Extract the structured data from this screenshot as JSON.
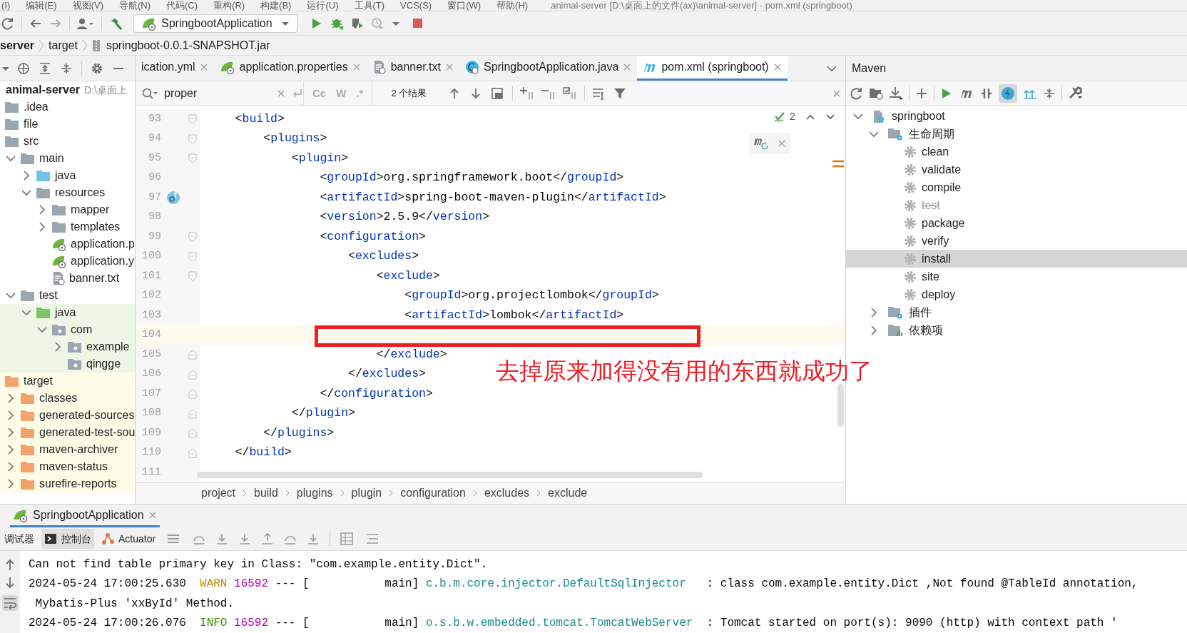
{
  "menu_bar": {
    "items": [
      "(I)",
      "编辑(E)",
      "视图(V)",
      "导航(N)",
      "代码(C)",
      "重构(R)",
      "构建(B)",
      "运行(U)",
      "工具(T)",
      "VCS(S)",
      "窗口(W)",
      "帮助(H)"
    ],
    "title": "animal-server [D:\\桌面上的文件(ax)\\animal-server] - pom.xml (springboot)"
  },
  "toolbar": {
    "run_configuration": "SpringbootApplication"
  },
  "navigation_bar": [
    {
      "label": "server",
      "kind": "project"
    },
    {
      "label": "target",
      "kind": "folder"
    },
    {
      "label": "springboot-0.0.1-SNAPSHOT.jar",
      "kind": "jar"
    }
  ],
  "project_panel": {
    "tree": [
      {
        "label": "animal-server",
        "kind": "module",
        "path_hint": "D:\\桌面上",
        "children": [
          {
            "label": ".idea",
            "kind": "folder"
          },
          {
            "label": "file",
            "kind": "folder"
          },
          {
            "label": "src",
            "kind": "folder",
            "children": [
              {
                "label": "main",
                "kind": "folder",
                "expanded": true,
                "children": [
                  {
                    "label": "java",
                    "kind": "source-folder",
                    "expanded": false
                  },
                  {
                    "label": "resources",
                    "kind": "resources-folder",
                    "expanded": true,
                    "children": [
                      {
                        "label": "mapper",
                        "kind": "folder",
                        "expanded": false
                      },
                      {
                        "label": "templates",
                        "kind": "folder",
                        "expanded": false
                      },
                      {
                        "label": "application.p",
                        "kind": "spring-file"
                      },
                      {
                        "label": "application.y",
                        "kind": "spring-file"
                      },
                      {
                        "label": "banner.txt",
                        "kind": "text-file"
                      }
                    ]
                  }
                ]
              },
              {
                "label": "test",
                "kind": "folder",
                "expanded": true,
                "children": [
                  {
                    "label": "java",
                    "kind": "test-folder",
                    "expanded": true,
                    "test_source": true,
                    "children": [
                      {
                        "label": "com",
                        "kind": "package",
                        "expanded": true,
                        "test_source": true,
                        "children": [
                          {
                            "label": "example",
                            "kind": "package",
                            "expanded": false,
                            "test_source": true
                          },
                          {
                            "label": "qingge",
                            "kind": "package",
                            "test_source": true
                          }
                        ]
                      }
                    ]
                  }
                ]
              }
            ]
          },
          {
            "label": "target",
            "kind": "excluded-folder",
            "excluded": true,
            "children": [
              {
                "label": "classes",
                "kind": "excluded-folder",
                "expanded": false,
                "excluded": true
              },
              {
                "label": "generated-sources",
                "kind": "excluded-folder",
                "expanded": false,
                "excluded": true
              },
              {
                "label": "generated-test-sou",
                "kind": "excluded-folder",
                "expanded": false,
                "excluded": true
              },
              {
                "label": "maven-archiver",
                "kind": "excluded-folder",
                "expanded": false,
                "excluded": true
              },
              {
                "label": "maven-status",
                "kind": "excluded-folder",
                "expanded": false,
                "excluded": true
              },
              {
                "label": "surefire-reports",
                "kind": "excluded-folder",
                "expanded": false,
                "excluded": true
              }
            ]
          }
        ]
      }
    ]
  },
  "editor": {
    "tabs": [
      {
        "label": "ication.yml",
        "selected": false
      },
      {
        "label": "application.properties",
        "kind": "spring-file",
        "selected": false
      },
      {
        "label": "banner.txt",
        "kind": "text-file",
        "selected": false
      },
      {
        "label": "SpringbootApplication.java",
        "kind": "java-file",
        "selected": false
      },
      {
        "label": "pom.xml (springboot)",
        "kind": "maven-file",
        "selected": true
      }
    ],
    "search": {
      "value": "proper",
      "toggles": [
        "Cc",
        "W",
        ".*"
      ],
      "results": "2 个结果"
    },
    "problems": "2",
    "lines": [
      {
        "number": "93",
        "code": "    <build>",
        "fold_start": true
      },
      {
        "number": "94",
        "code": "        <plugins>",
        "fold_start": true
      },
      {
        "number": "95",
        "code": "            <plugin>",
        "fold_start": true
      },
      {
        "number": "96",
        "code": "                <groupId>org.springframework.boot</groupId>"
      },
      {
        "number": "97",
        "code": "                <artifactId>spring-boot-maven-plugin</artifactId>",
        "gutter_icon": true
      },
      {
        "number": "98",
        "code": "                <version>2.5.9</version>"
      },
      {
        "number": "99",
        "code": "                <configuration>",
        "fold_start": true
      },
      {
        "number": "100",
        "code": "                    <excludes>",
        "fold_start": true
      },
      {
        "number": "101",
        "code": "                        <exclude>",
        "fold_start": true
      },
      {
        "number": "102",
        "code": "                            <groupId>org.projectlombok</groupId>"
      },
      {
        "number": "103",
        "code": "                            <artifactId>lombok</artifactId>"
      },
      {
        "number": "104",
        "current": true
      },
      {
        "number": "105",
        "code": "                        </exclude>",
        "fold_end": true
      },
      {
        "number": "106",
        "code": "                    </excludes>",
        "fold_end": true
      },
      {
        "number": "107",
        "code": "                </configuration>",
        "fold_end": true
      },
      {
        "number": "108",
        "code": "            </plugin>",
        "fold_end": true
      },
      {
        "number": "109",
        "code": "        </plugins>",
        "fold_end": true
      },
      {
        "number": "110",
        "code": "    </build>",
        "fold_end": true
      },
      {
        "number": "111"
      }
    ],
    "breadcrumbs": [
      "project",
      "build",
      "plugins",
      "plugin",
      "configuration",
      "excludes",
      "exclude"
    ]
  },
  "annotation": {
    "text": "去掉原来加得没有用的东西就成功了"
  },
  "maven_panel": {
    "title": "Maven",
    "tree": [
      {
        "label": "springboot",
        "kind": "project",
        "expanded": true,
        "children": [
          {
            "label": "生命周期",
            "kind": "group",
            "expanded": true,
            "children": [
              {
                "label": "clean",
                "kind": "goal",
                "disabled": false,
                "selected": false
              },
              {
                "label": "validate",
                "kind": "goal",
                "disabled": false,
                "selected": false
              },
              {
                "label": "compile",
                "kind": "goal",
                "disabled": false,
                "selected": false
              },
              {
                "label": "test",
                "kind": "goal",
                "disabled": true,
                "selected": false
              },
              {
                "label": "package",
                "kind": "goal",
                "disabled": false,
                "selected": false
              },
              {
                "label": "verify",
                "kind": "goal",
                "disabled": false,
                "selected": false
              },
              {
                "label": "install",
                "kind": "goal",
                "disabled": false,
                "selected": true
              },
              {
                "label": "site",
                "kind": "goal",
                "disabled": false,
                "selected": false
              },
              {
                "label": "deploy",
                "kind": "goal",
                "disabled": false,
                "selected": false
              }
            ]
          },
          {
            "label": "插件",
            "kind": "group",
            "expanded": false
          },
          {
            "label": "依赖项",
            "kind": "dependencies",
            "expanded": false
          }
        ]
      }
    ]
  },
  "run_panel": {
    "tab": "SpringbootApplication",
    "tabs": [
      {
        "label": "调试器",
        "kind": "plain",
        "selected": false
      },
      {
        "label": "控制台",
        "kind": "console",
        "selected": true
      },
      {
        "label": "Actuator",
        "kind": "actuator",
        "selected": false
      }
    ],
    "console": [
      [
        {
          "text": "Can not find table primary key in Class: \"com.example.entity.Dict\".",
          "kind": "plain"
        }
      ],
      [
        {
          "text": "2024-05-24 17:00:25.630  ",
          "kind": "plain"
        },
        {
          "text": "WARN",
          "kind": "warn"
        },
        {
          "text": "16592",
          "kind": "pid"
        },
        {
          "text": " --- [           main] ",
          "kind": "plain"
        },
        {
          "text": "c.b.m.core.injector.DefaultSqlInjector",
          "kind": "logger"
        },
        {
          "text": "   : class com.example.entity.Dict ,Not found @TableId annotation,",
          "kind": "plain"
        }
      ],
      [
        {
          "text": " Mybatis-Plus 'xxById' Method.",
          "kind": "plain"
        }
      ],
      [
        {
          "text": "2024-05-24 17:00:26.076  ",
          "kind": "plain"
        },
        {
          "text": "INFO",
          "kind": "info"
        },
        {
          "text": "16592",
          "kind": "pid"
        },
        {
          "text": " --- [           main] ",
          "kind": "plain"
        },
        {
          "text": "o.s.b.w.embedded.tomcat.TomcatWebServer",
          "kind": "logger"
        },
        {
          "text": "  : Tomcat started on port(s): 9090 (http) with context path '",
          "kind": "plain"
        }
      ]
    ]
  }
}
